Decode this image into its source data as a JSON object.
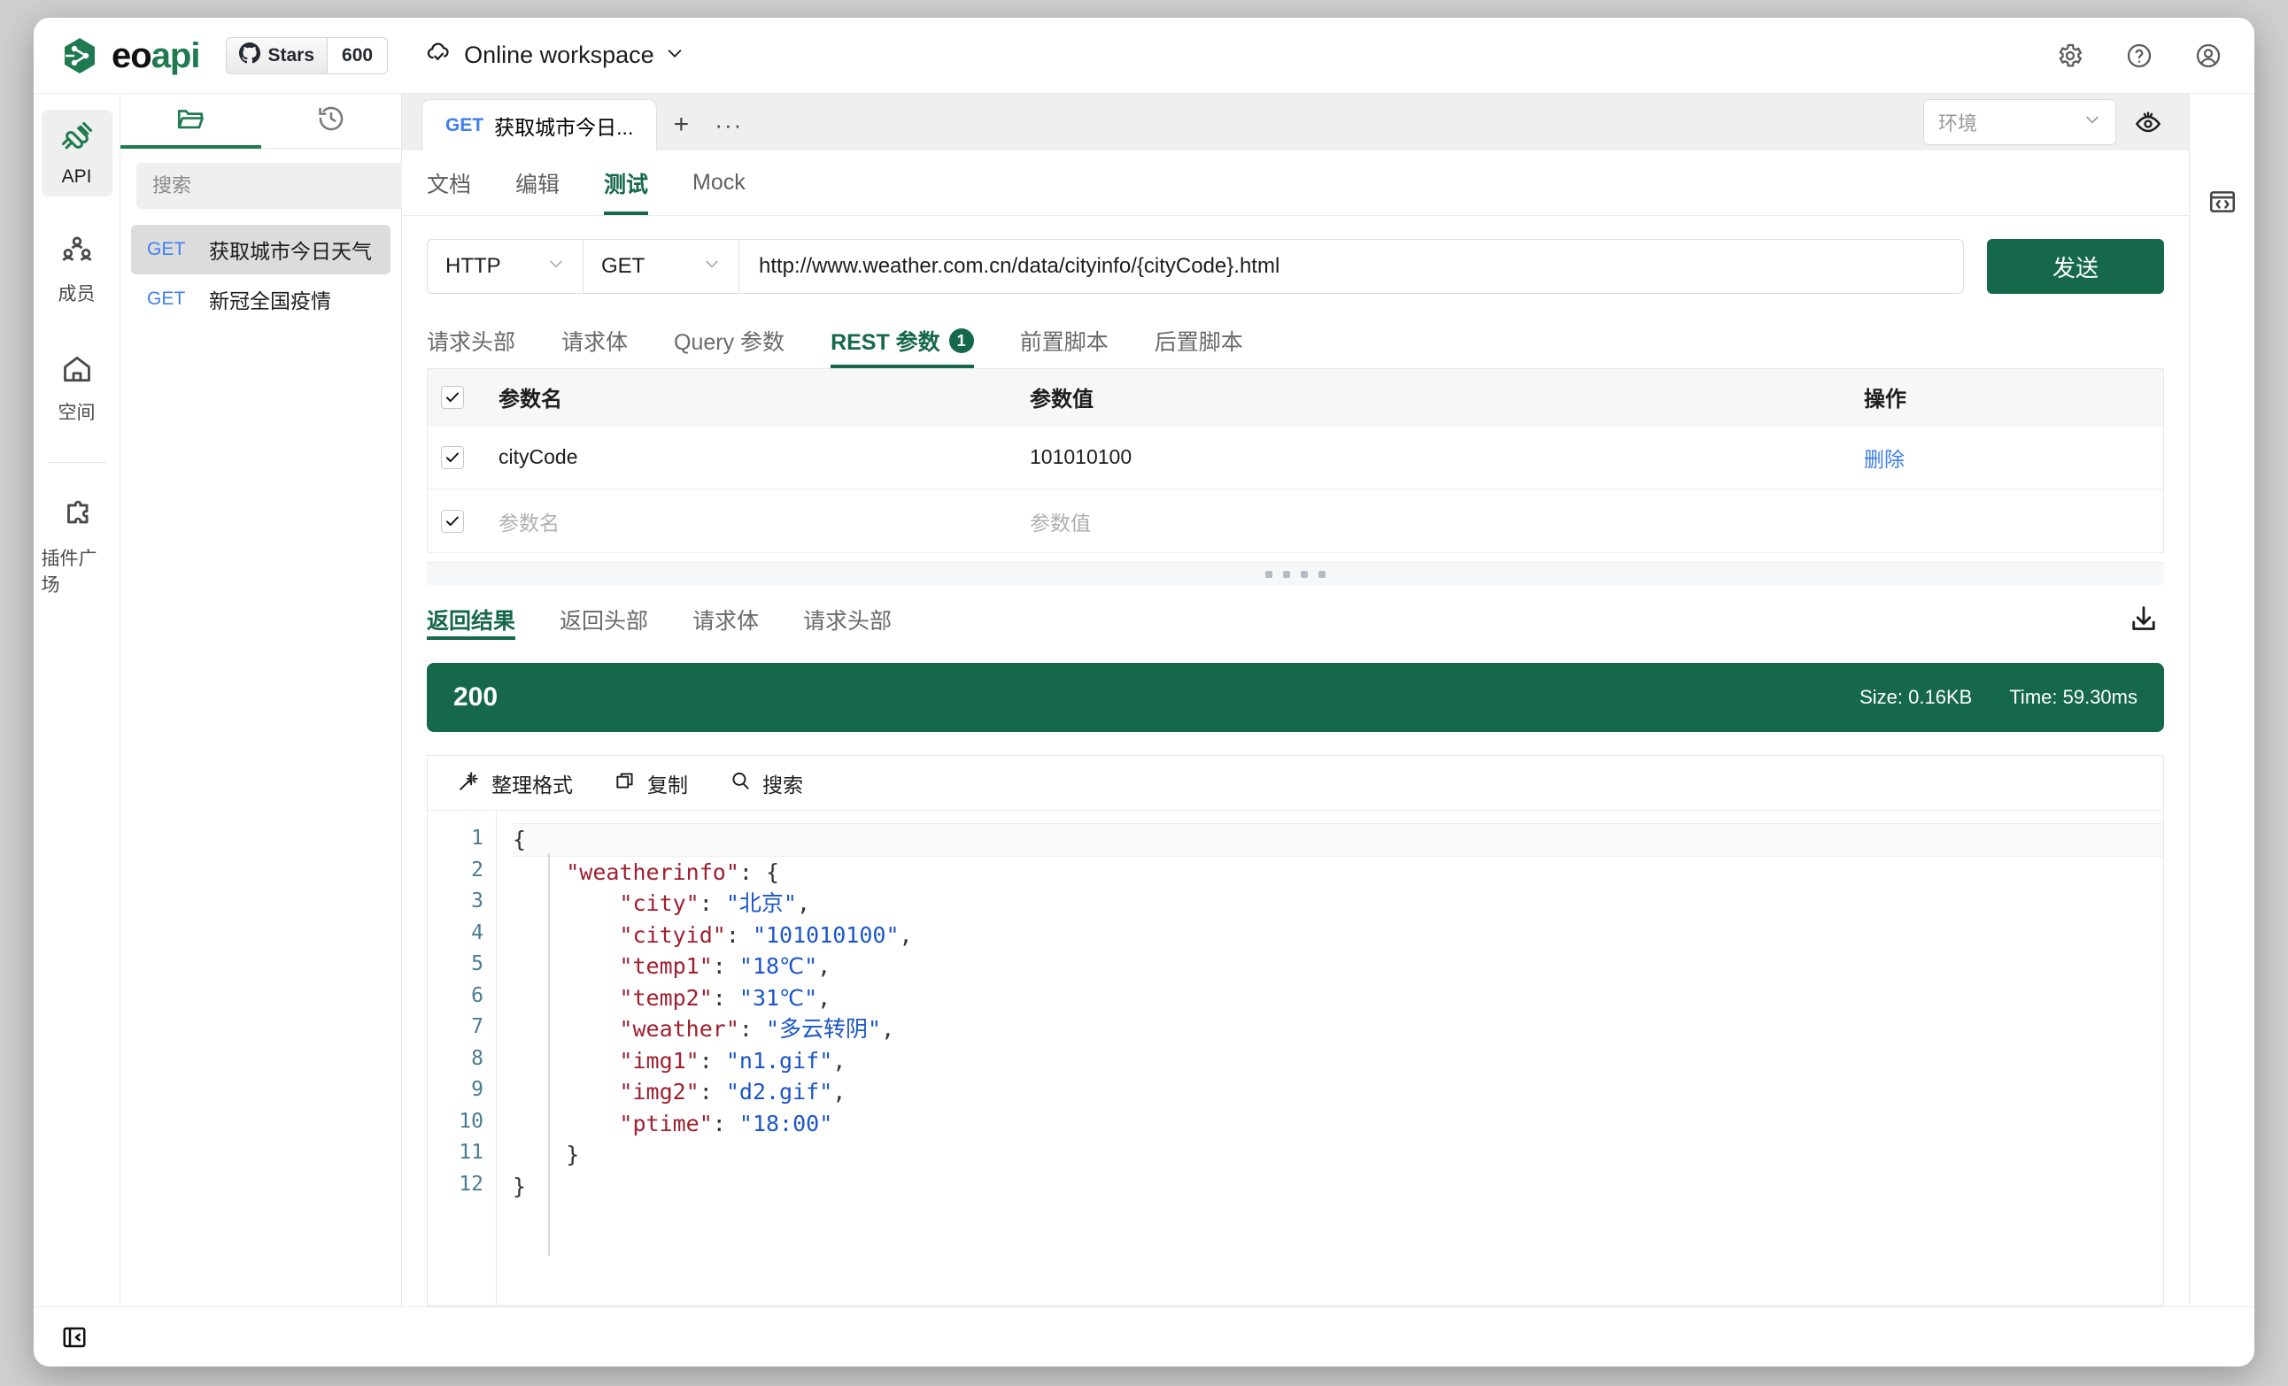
{
  "topbar": {
    "brand": "eoapi",
    "stars_label": "Stars",
    "stars_count": "600",
    "workspace": "Online workspace",
    "icons": {
      "settings": "gear-icon",
      "help": "question-icon",
      "account": "user-icon"
    }
  },
  "rail": {
    "items": [
      {
        "label": "API",
        "icon": "api-icon",
        "active": true
      },
      {
        "label": "成员",
        "icon": "members-icon",
        "active": false
      },
      {
        "label": "空间",
        "icon": "home-icon",
        "active": false
      },
      {
        "label": "插件广场",
        "icon": "plugin-icon",
        "active": false
      }
    ]
  },
  "explorer": {
    "tabs": [
      {
        "name": "folder-tab",
        "icon": "folder-icon",
        "active": true
      },
      {
        "name": "history-tab",
        "icon": "history-icon",
        "active": false
      }
    ],
    "search_placeholder": "搜索",
    "search_value": "",
    "add_label": "+",
    "items": [
      {
        "method": "GET",
        "name": "获取城市今日天气",
        "selected": true
      },
      {
        "method": "GET",
        "name": "新冠全国疫情",
        "selected": false
      }
    ]
  },
  "tabbar": {
    "open_tabs": [
      {
        "method": "GET",
        "title": "获取城市今日..."
      }
    ],
    "new_tab_label": "+",
    "more_label": "···",
    "env_placeholder": "环境",
    "eye_icon": "eye-icon"
  },
  "sub_tabs": [
    {
      "label": "文档",
      "active": false
    },
    {
      "label": "编辑",
      "active": false
    },
    {
      "label": "测试",
      "active": true
    },
    {
      "label": "Mock",
      "active": false
    }
  ],
  "request": {
    "protocol": "HTTP",
    "method": "GET",
    "url": "http://www.weather.com.cn/data/cityinfo/{cityCode}.html",
    "send_label": "发送"
  },
  "param_tabs": [
    {
      "label": "请求头部",
      "badge": "",
      "active": false
    },
    {
      "label": "请求体",
      "badge": "",
      "active": false
    },
    {
      "label": "Query 参数",
      "badge": "",
      "active": false
    },
    {
      "label": "REST 参数",
      "badge": "1",
      "active": true
    },
    {
      "label": "前置脚本",
      "badge": "",
      "active": false
    },
    {
      "label": "后置脚本",
      "badge": "",
      "active": false
    }
  ],
  "param_table": {
    "headers": {
      "name": "参数名",
      "value": "参数值",
      "action": "操作"
    },
    "rows": [
      {
        "checked": true,
        "name": "cityCode",
        "value": "101010100",
        "action": "删除",
        "placeholder": false
      }
    ],
    "empty_row": {
      "checked": true,
      "name_placeholder": "参数名",
      "value_placeholder": "参数值"
    }
  },
  "response": {
    "tabs": [
      {
        "label": "返回结果",
        "active": true
      },
      {
        "label": "返回头部",
        "active": false
      },
      {
        "label": "请求体",
        "active": false
      },
      {
        "label": "请求头部",
        "active": false
      }
    ],
    "download_icon": "download-icon",
    "status_code": "200",
    "size": "Size: 0.16KB",
    "time": "Time: 59.30ms",
    "toolbar": [
      {
        "label": "整理格式",
        "icon": "magic-wand-icon"
      },
      {
        "label": "复制",
        "icon": "copy-icon"
      },
      {
        "label": "搜索",
        "icon": "search-icon"
      }
    ],
    "code_lines": [
      {
        "n": "1",
        "segments": [
          {
            "t": "{",
            "c": "p"
          }
        ]
      },
      {
        "n": "2",
        "segments": [
          {
            "t": "    ",
            "c": "p"
          },
          {
            "t": "\"weatherinfo\"",
            "c": "k"
          },
          {
            "t": ": {",
            "c": "p"
          }
        ]
      },
      {
        "n": "3",
        "segments": [
          {
            "t": "        ",
            "c": "p"
          },
          {
            "t": "\"city\"",
            "c": "k"
          },
          {
            "t": ": ",
            "c": "p"
          },
          {
            "t": "\"北京\"",
            "c": "v"
          },
          {
            "t": ",",
            "c": "p"
          }
        ]
      },
      {
        "n": "4",
        "segments": [
          {
            "t": "        ",
            "c": "p"
          },
          {
            "t": "\"cityid\"",
            "c": "k"
          },
          {
            "t": ": ",
            "c": "p"
          },
          {
            "t": "\"101010100\"",
            "c": "v"
          },
          {
            "t": ",",
            "c": "p"
          }
        ]
      },
      {
        "n": "5",
        "segments": [
          {
            "t": "        ",
            "c": "p"
          },
          {
            "t": "\"temp1\"",
            "c": "k"
          },
          {
            "t": ": ",
            "c": "p"
          },
          {
            "t": "\"18℃\"",
            "c": "v"
          },
          {
            "t": ",",
            "c": "p"
          }
        ]
      },
      {
        "n": "6",
        "segments": [
          {
            "t": "        ",
            "c": "p"
          },
          {
            "t": "\"temp2\"",
            "c": "k"
          },
          {
            "t": ": ",
            "c": "p"
          },
          {
            "t": "\"31℃\"",
            "c": "v"
          },
          {
            "t": ",",
            "c": "p"
          }
        ]
      },
      {
        "n": "7",
        "segments": [
          {
            "t": "        ",
            "c": "p"
          },
          {
            "t": "\"weather\"",
            "c": "k"
          },
          {
            "t": ": ",
            "c": "p"
          },
          {
            "t": "\"多云转阴\"",
            "c": "v"
          },
          {
            "t": ",",
            "c": "p"
          }
        ]
      },
      {
        "n": "8",
        "segments": [
          {
            "t": "        ",
            "c": "p"
          },
          {
            "t": "\"img1\"",
            "c": "k"
          },
          {
            "t": ": ",
            "c": "p"
          },
          {
            "t": "\"n1.gif\"",
            "c": "v"
          },
          {
            "t": ",",
            "c": "p"
          }
        ]
      },
      {
        "n": "9",
        "segments": [
          {
            "t": "        ",
            "c": "p"
          },
          {
            "t": "\"img2\"",
            "c": "k"
          },
          {
            "t": ": ",
            "c": "p"
          },
          {
            "t": "\"d2.gif\"",
            "c": "v"
          },
          {
            "t": ",",
            "c": "p"
          }
        ]
      },
      {
        "n": "10",
        "segments": [
          {
            "t": "        ",
            "c": "p"
          },
          {
            "t": "\"ptime\"",
            "c": "k"
          },
          {
            "t": ": ",
            "c": "p"
          },
          {
            "t": "\"18:00\"",
            "c": "v"
          }
        ]
      },
      {
        "n": "11",
        "segments": [
          {
            "t": "    }",
            "c": "p"
          }
        ]
      },
      {
        "n": "12",
        "segments": [
          {
            "t": "}",
            "c": "p"
          }
        ]
      }
    ]
  },
  "right_rail": {
    "code_icon": "code-brackets-icon"
  },
  "footer": {
    "collapse_icon": "collapse-panel-icon"
  },
  "colors": {
    "brand_green": "#16684a",
    "accent_blue": "#3f7ef0",
    "status_green": "#16684a",
    "json_key": "#a02030",
    "json_value": "#1a55c9"
  }
}
